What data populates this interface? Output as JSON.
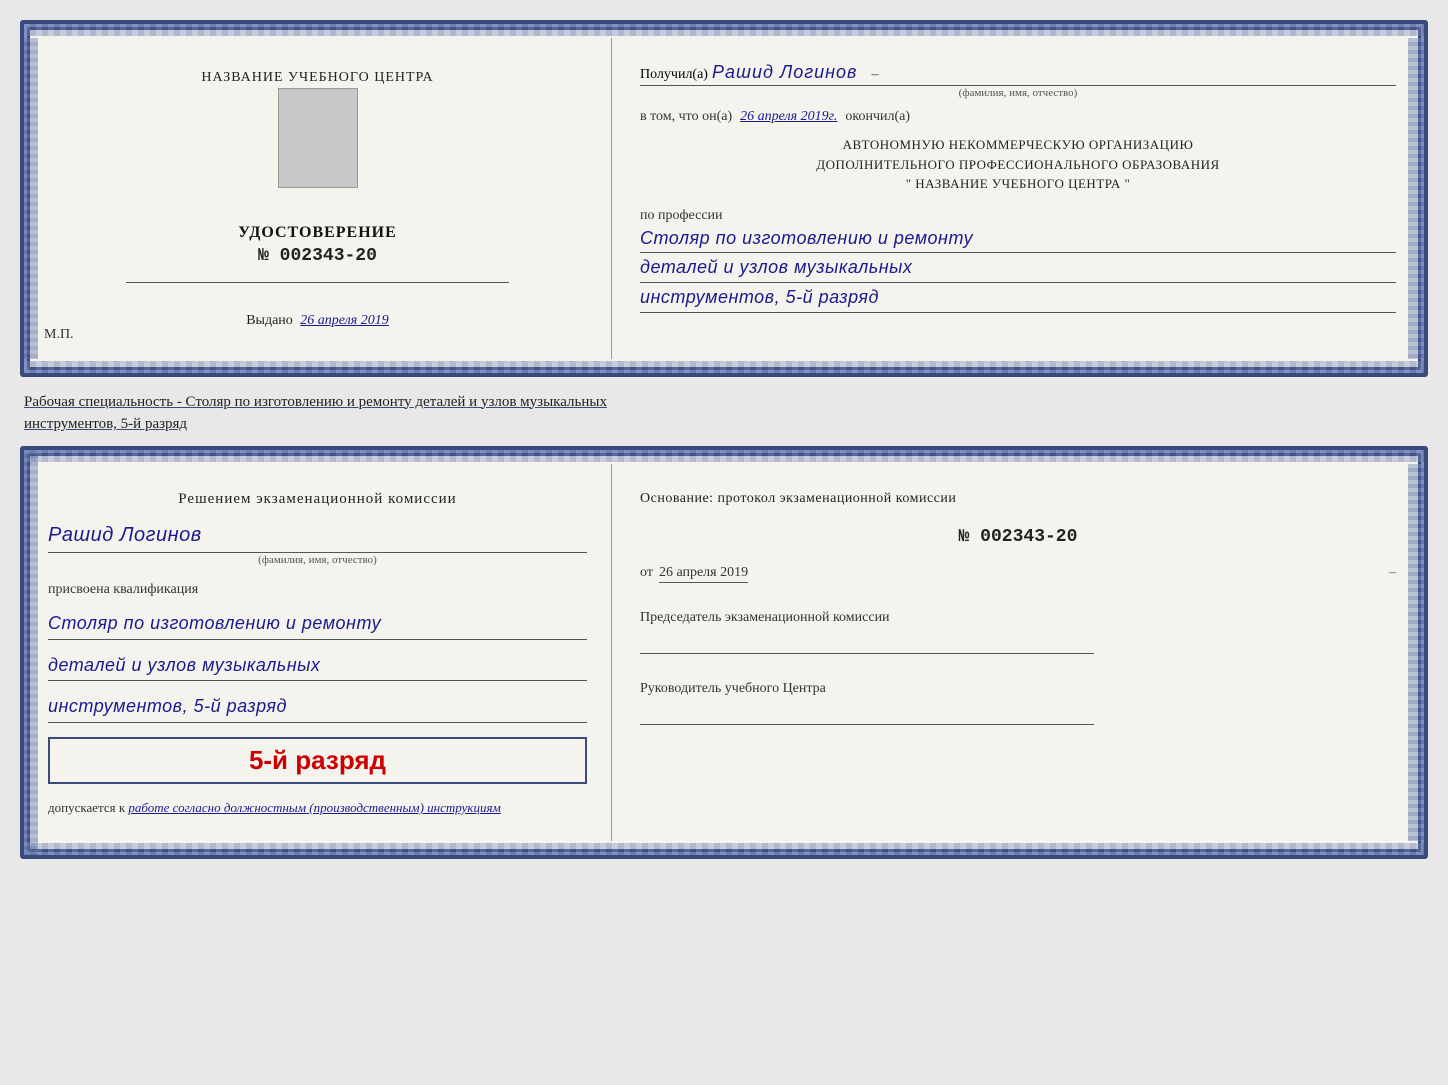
{
  "card1": {
    "left": {
      "title": "НАЗВАНИЕ УЧЕБНОГО ЦЕНТРА",
      "cert_label": "УДОСТОВЕРЕНИЕ",
      "cert_number": "№ 002343-20",
      "issued_label": "Выдано",
      "issued_date": "26 апреля 2019",
      "mp_label": "М.П."
    },
    "right": {
      "recipient_prefix": "Получил(а)",
      "recipient_name": "Рашид Логинов",
      "recipient_sub": "(фамилия, имя, отчество)",
      "date_prefix": "в том, что он(а)",
      "date_value": "26 апреля 2019г.",
      "date_suffix": "окончил(а)",
      "org_line1": "АВТОНОМНУЮ НЕКОММЕРЧЕСКУЮ ОРГАНИЗАЦИЮ",
      "org_line2": "ДОПОЛНИТЕЛЬНОГО ПРОФЕССИОНАЛЬНОГО ОБРАЗОВАНИЯ",
      "org_line3": "\" НАЗВАНИЕ УЧЕБНОГО ЦЕНТРА \"",
      "profession_label": "по профессии",
      "profession_line1": "Столяр по изготовлению и ремонту",
      "profession_line2": "деталей и узлов музыкальных",
      "profession_line3": "инструментов, 5-й разряд"
    }
  },
  "specialty_text": "Рабочая специальность - Столяр по изготовлению и ремонту деталей и узлов музыкальных",
  "specialty_text2": "инструментов, 5-й разряд",
  "card2": {
    "left": {
      "commission_heading": "Решением  экзаменационной  комиссии",
      "person_name": "Рашид Логинов",
      "person_sub": "(фамилия, имя, отчество)",
      "qualification_label": "присвоена квалификация",
      "qual_line1": "Столяр по изготовлению и ремонту",
      "qual_line2": "деталей и узлов музыкальных",
      "qual_line3": "инструментов, 5-й разряд",
      "rank_big": "5-й разряд",
      "admission_label": "допускается к",
      "admission_text": "работе согласно должностным (производственным) инструкциям"
    },
    "right": {
      "basis_text": "Основание: протокол экзаменационной  комиссии",
      "protocol_number": "№  002343-20",
      "date_label": "от",
      "date_value": "26 апреля 2019",
      "chairman_label": "Председатель экзаменационной комиссии",
      "director_label": "Руководитель учебного Центра"
    }
  }
}
